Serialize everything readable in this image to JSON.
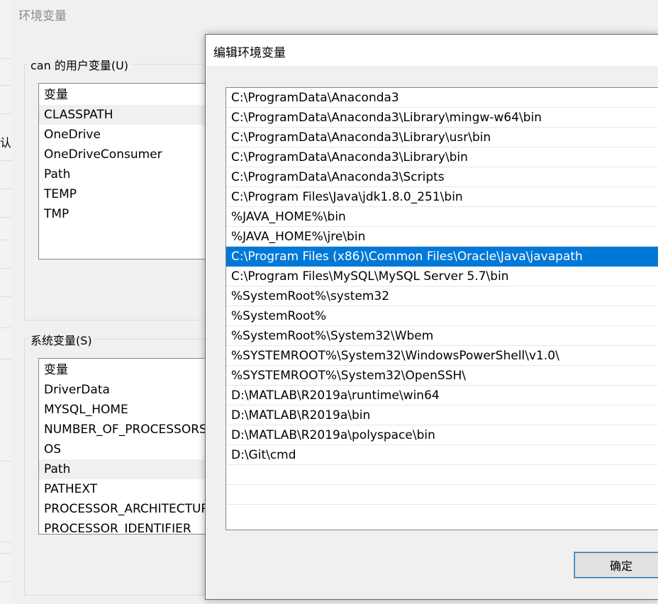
{
  "env_window": {
    "title": "环境变量",
    "user_group_label": "can 的用户变量(U)",
    "user_vars": {
      "header": "变量",
      "items": [
        "CLASSPATH",
        "OneDrive",
        "OneDriveConsumer",
        "Path",
        "TEMP",
        "TMP"
      ],
      "selected": "CLASSPATH"
    },
    "system_group_label": "系统变量(S)",
    "system_vars": {
      "header": "变量",
      "items": [
        "DriverData",
        "MYSQL_HOME",
        "NUMBER_OF_PROCESSORS",
        "OS",
        "Path",
        "PATHEXT",
        "PROCESSOR_ARCHITECTURE",
        "PROCESSOR_IDENTIFIER"
      ],
      "selected": "Path"
    }
  },
  "background_clip_text": "认内",
  "edit_dialog": {
    "title": "编辑环境变量",
    "paths": [
      "C:\\ProgramData\\Anaconda3",
      "C:\\ProgramData\\Anaconda3\\Library\\mingw-w64\\bin",
      "C:\\ProgramData\\Anaconda3\\Library\\usr\\bin",
      "C:\\ProgramData\\Anaconda3\\Library\\bin",
      "C:\\ProgramData\\Anaconda3\\Scripts",
      "C:\\Program Files\\Java\\jdk1.8.0_251\\bin",
      "%JAVA_HOME%\\bin",
      "%JAVA_HOME%\\jre\\bin",
      "C:\\Program Files (x86)\\Common Files\\Oracle\\Java\\javapath",
      "C:\\Program Files\\MySQL\\MySQL Server 5.7\\bin",
      "%SystemRoot%\\system32",
      "%SystemRoot%",
      "%SystemRoot%\\System32\\Wbem",
      "%SYSTEMROOT%\\System32\\WindowsPowerShell\\v1.0\\",
      "%SYSTEMROOT%\\System32\\OpenSSH\\",
      "D:\\MATLAB\\R2019a\\runtime\\win64",
      "D:\\MATLAB\\R2019a\\bin",
      "D:\\MATLAB\\R2019a\\polyspace\\bin",
      "D:\\Git\\cmd"
    ],
    "selected_index": 8,
    "ok_label": "确定"
  }
}
